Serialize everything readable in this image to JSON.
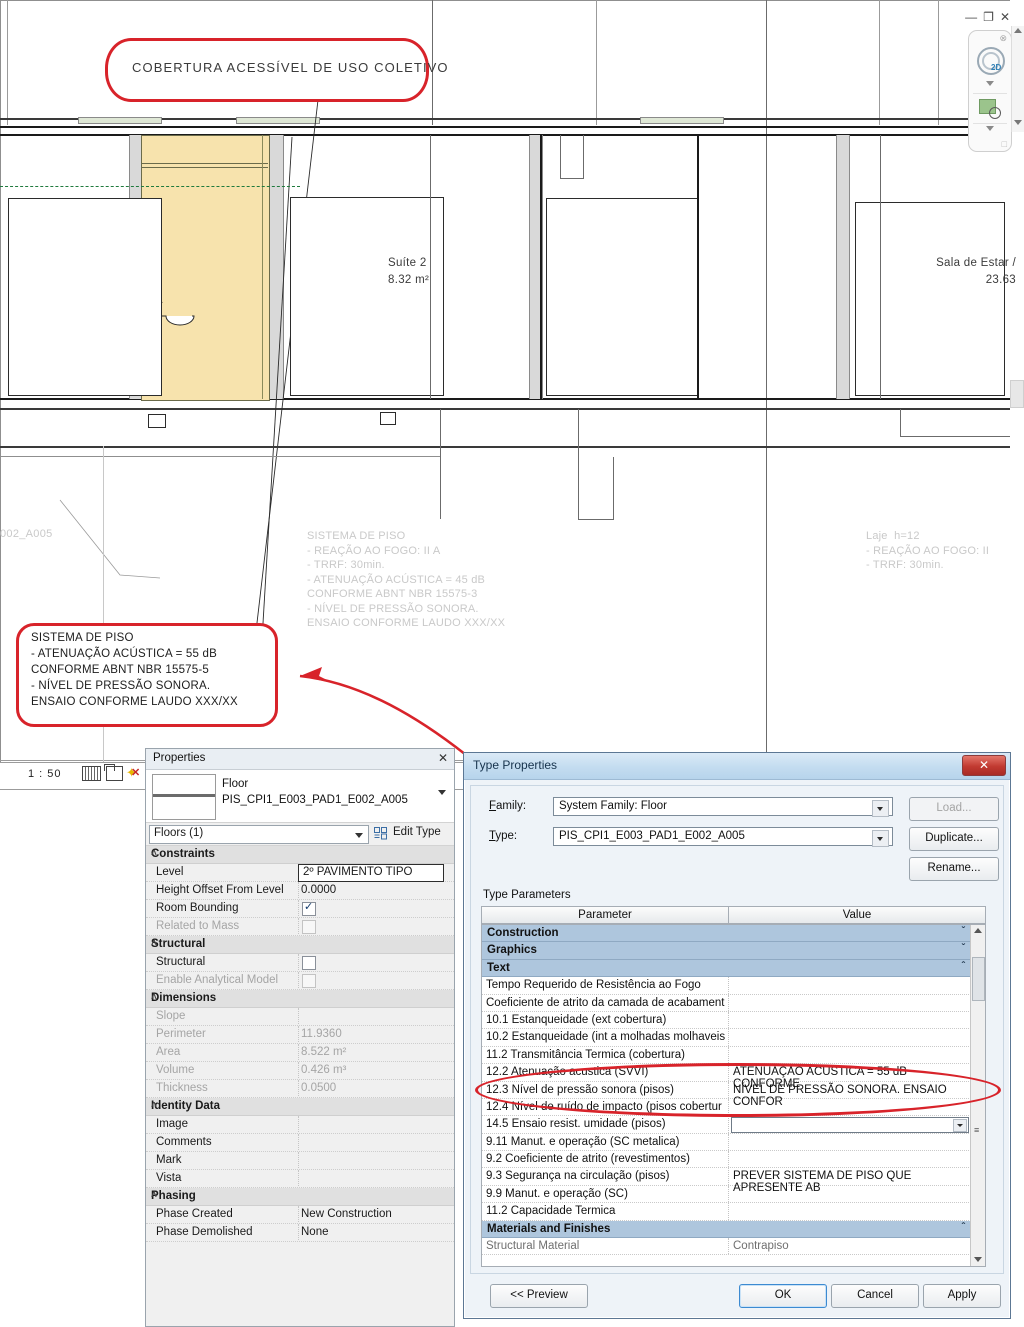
{
  "window": {
    "minimize_label": "—",
    "restore_label": "❐",
    "close_label": "✕"
  },
  "navbar": {
    "close_label": "⊗",
    "wheel_label": "2D",
    "zoom_label": "zoom-region"
  },
  "canvas": {
    "title_callout": "COBERTURA ACESSÍVEL DE USO COLETIVO",
    "rooms": [
      {
        "name": "Suíte 2",
        "area": "8.32 m²"
      },
      {
        "name": "Sala de Estar /",
        "area": "23.63"
      }
    ],
    "left_edge_label": "002_A005",
    "note_center": "SISTEMA DE PISO\n- REAÇÃO AO FOGO: II A\n- TRRF: 30min.\n- ATENUAÇÃO ACÚSTICA = 45 dB\nCONFORME ABNT NBR 15575-3\n- NÍVEL DE PRESSÃO SONORA.\nENSAIO CONFORME LAUDO XXX/XX",
    "note_right": "Laje  h=12\n- REAÇÃO AO FOGO: II\n- TRRF: 30min.",
    "red_callout": "SISTEMA DE PISO\n- ATENUAÇÃO ACÚSTICA = 55 dB\nCONFORME ABNT NBR 15575-5\n- NÍVEL DE PRESSÃO SONORA.\nENSAIO CONFORME LAUDO XXX/XX",
    "status": {
      "scale": "1 : 50",
      "icons": [
        "grid-icon",
        "box-icon",
        "hide-warnings-icon"
      ]
    }
  },
  "properties": {
    "title": "Properties",
    "close_label": "✕",
    "family_label": "Floor",
    "type_label": "PIS_CPI1_E003_PAD1_E002_A005",
    "selector_value": "Floors (1)",
    "edit_type_label": "Edit Type",
    "groups": [
      {
        "name": "Constraints",
        "rows": [
          {
            "key": "Level",
            "value": "2º PAVIMENTO TIPO",
            "kind": "highlight"
          },
          {
            "key": "Height Offset From Level",
            "value": "0.0000",
            "kind": "text"
          },
          {
            "key": "Room Bounding",
            "value": "",
            "kind": "checkbox-checked"
          },
          {
            "key": "Related to Mass",
            "value": "",
            "kind": "checkbox-disabled",
            "disabled": true
          }
        ]
      },
      {
        "name": "Structural",
        "rows": [
          {
            "key": "Structural",
            "value": "",
            "kind": "checkbox"
          },
          {
            "key": "Enable Analytical Model",
            "value": "",
            "kind": "checkbox-disabled",
            "disabled": true
          }
        ]
      },
      {
        "name": "Dimensions",
        "rows": [
          {
            "key": "Slope",
            "value": "",
            "kind": "text",
            "disabled": true
          },
          {
            "key": "Perimeter",
            "value": "11.9360",
            "kind": "text",
            "disabled": true
          },
          {
            "key": "Area",
            "value": "8.522 m²",
            "kind": "text",
            "disabled": true
          },
          {
            "key": "Volume",
            "value": "0.426 m³",
            "kind": "text",
            "disabled": true
          },
          {
            "key": "Thickness",
            "value": "0.0500",
            "kind": "text",
            "disabled": true
          }
        ]
      },
      {
        "name": "Identity Data",
        "rows": [
          {
            "key": "Image",
            "value": "",
            "kind": "text"
          },
          {
            "key": "Comments",
            "value": "",
            "kind": "text"
          },
          {
            "key": "Mark",
            "value": "",
            "kind": "text"
          },
          {
            "key": "Vista",
            "value": "",
            "kind": "text"
          }
        ]
      },
      {
        "name": "Phasing",
        "rows": [
          {
            "key": "Phase Created",
            "value": "New Construction",
            "kind": "text"
          },
          {
            "key": "Phase Demolished",
            "value": "None",
            "kind": "text"
          }
        ]
      }
    ]
  },
  "dialog": {
    "title": "Type Properties",
    "close_label": "✕",
    "family_field_label": "Family:",
    "family_value": "System Family: Floor",
    "type_field_label": "Type:",
    "type_value": "PIS_CPI1_E003_PAD1_E002_A005",
    "load_button": "Load...",
    "duplicate_button": "Duplicate...",
    "rename_button": "Rename...",
    "type_parameters_label": "Type Parameters",
    "col_parameter": "Parameter",
    "col_value": "Value",
    "rows": [
      {
        "key": "Construction",
        "value": "",
        "section": true,
        "chev": "ˇ"
      },
      {
        "key": "Graphics",
        "value": "",
        "section": true,
        "chev": "ˇ"
      },
      {
        "key": "Text",
        "value": "",
        "section": true,
        "chev": "ˆ"
      },
      {
        "key": "Tempo Requerido de Resistência ao Fogo",
        "value": ""
      },
      {
        "key": "Coeficiente de atrito da camada de acabament",
        "value": ""
      },
      {
        "key": "10.1 Estanqueidade (ext cobertura)",
        "value": ""
      },
      {
        "key": "10.2 Estanqueidade (int a molhadas molhaveis",
        "value": ""
      },
      {
        "key": "11.2 Transmitância Termica (cobertura)",
        "value": ""
      },
      {
        "key": "12.2 Atenuação acustica (SVVI)",
        "value": "ATENUAÇÃO ACÚSTICA = 55 dB CONFORME"
      },
      {
        "key": "12.3 Nível de pressão sonora (pisos)",
        "value": "NÍVEL DE PRESSÃO SONORA. ENSAIO CONFOR"
      },
      {
        "key": "12.4 Nível de ruído de impacto (pisos cobertur",
        "value": ""
      },
      {
        "key": "14.5 Ensaio resist. umidade (pisos)",
        "value": "",
        "dropdown": true
      },
      {
        "key": "9.11 Manut. e operação (SC metalica)",
        "value": ""
      },
      {
        "key": "9.2 Coeficiente de atrito (revestimentos)",
        "value": ""
      },
      {
        "key": "9.3 Segurança na circulação (pisos)",
        "value": "PREVER SISTEMA DE PISO QUE APRESENTE AB"
      },
      {
        "key": "9.9 Manut. e operação (SC)",
        "value": ""
      },
      {
        "key": "11.2 Capacidade Termica",
        "value": ""
      },
      {
        "key": "Materials and Finishes",
        "value": "",
        "section": true,
        "chev": "ˆ"
      },
      {
        "key": "Structural Material",
        "value": "Contrapiso",
        "grey": true
      }
    ],
    "preview_button": "<< Preview",
    "ok_button": "OK",
    "cancel_button": "Cancel",
    "apply_button": "Apply"
  },
  "colors": {
    "annotation_red": "#d8232a",
    "section_blue": "#aec6dd",
    "room_fill": "#f7e3ad",
    "green_dash": "#1f7a3d"
  }
}
